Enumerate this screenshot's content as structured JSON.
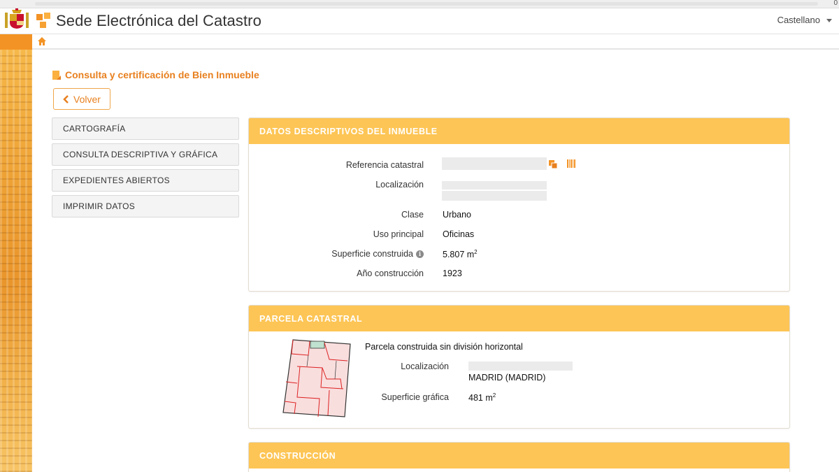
{
  "browser": {
    "corner_text": "0"
  },
  "header": {
    "site_title": "Sede Electrónica del Catastro",
    "language": "Castellano",
    "accent_color": "#f39325"
  },
  "page": {
    "title": "Consulta y certificación de Bien Inmueble",
    "back_label": "Volver"
  },
  "menu": {
    "items": [
      {
        "label": "CARTOGRAFÍA"
      },
      {
        "label": "CONSULTA DESCRIPTIVA Y GRÁFICA"
      },
      {
        "label": "EXPEDIENTES ABIERTOS"
      },
      {
        "label": "IMPRIMIR DATOS"
      }
    ]
  },
  "datos": {
    "heading": "DATOS DESCRIPTIVOS DEL INMUEBLE",
    "ref_label": "Referencia catastral",
    "loc_label": "Localización",
    "clase_label": "Clase",
    "clase_value": "Urbano",
    "uso_label": "Uso principal",
    "uso_value": "Oficinas",
    "sup_label": "Superficie construida",
    "sup_value": "5.807 m",
    "sup_unit_exp": "2",
    "anio_label": "Año construcción",
    "anio_value": "1923"
  },
  "parcela": {
    "heading": "PARCELA CATASTRAL",
    "desc": "Parcela construida sin división horizontal",
    "loc_label": "Localización",
    "loc_city": "MADRID (MADRID)",
    "sup_label": "Superficie gráfica",
    "sup_value": "481 m",
    "sup_unit_exp": "2"
  },
  "construccion": {
    "heading": "CONSTRUCCIÓN"
  },
  "colors": {
    "panel_header": "#fdc555",
    "title_orange": "#e8801f"
  }
}
